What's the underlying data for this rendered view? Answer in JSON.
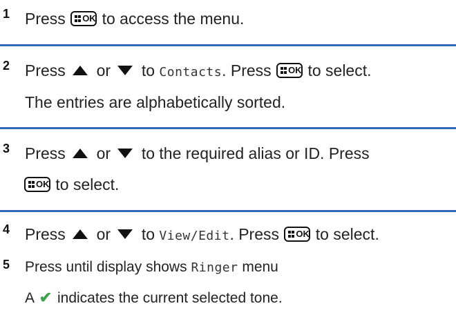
{
  "steps": [
    {
      "number": "1",
      "press": "Press",
      "tail": "to access the menu."
    },
    {
      "number": "2",
      "press": "Press",
      "or": "or",
      "to": "to",
      "target": "Contacts",
      "press2": ". Press",
      "tail": "to select.",
      "note": "The entries are alphabetically sorted."
    },
    {
      "number": "3",
      "press": "Press",
      "or": "or",
      "tail1": "to the required alias or ID. Press",
      "tail2": "to select."
    },
    {
      "number": "4",
      "press": "Press",
      "or": "or",
      "to": "to",
      "target": "View/Edit",
      "press2": ". Press",
      "tail": "to select."
    },
    {
      "number": "5",
      "text": "Press until display shows",
      "target": "Ringer",
      "tail": "menu",
      "note_a": "A",
      "note_b": "indicates the current selected tone."
    }
  ],
  "ok_button_label": "OK",
  "colors": {
    "divider": "#2f6cb5",
    "check": "#3fa34d"
  },
  "icons": [
    "ok-menu-button-icon",
    "up-arrow-icon",
    "down-arrow-icon",
    "checkmark-icon"
  ]
}
